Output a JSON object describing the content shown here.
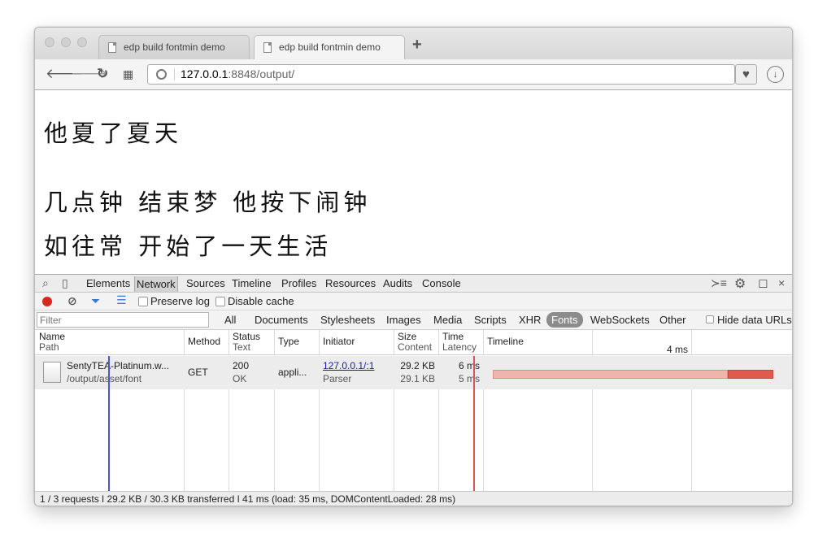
{
  "browser": {
    "tabs": [
      {
        "title": "edp build fontmin demo"
      },
      {
        "title": "edp build fontmin demo"
      }
    ],
    "url_host": "127.0.0.1",
    "url_rest": ":8848/output/"
  },
  "page": {
    "lines": [
      "他夏了夏天",
      "几点钟 结束梦 他按下闹钟",
      "如往常 开始了一天生活"
    ]
  },
  "devtools": {
    "panels": [
      "Elements",
      "Network",
      "Sources",
      "Timeline",
      "Profiles",
      "Resources",
      "Audits",
      "Console"
    ],
    "selected_panel": "Network",
    "preserve_log": "Preserve log",
    "disable_cache": "Disable cache",
    "filter_placeholder": "Filter",
    "types": [
      "All",
      "Documents",
      "Stylesheets",
      "Images",
      "Media",
      "Scripts",
      "XHR",
      "Fonts",
      "WebSockets",
      "Other"
    ],
    "selected_type": "Fonts",
    "hide_data_urls": "Hide data URLs",
    "columns": {
      "name": "Name",
      "path": "Path",
      "method": "Method",
      "status": "Status",
      "text": "Text",
      "type": "Type",
      "initiator": "Initiator",
      "size": "Size",
      "content": "Content",
      "time": "Time",
      "latency": "Latency",
      "timeline": "Timeline",
      "timeline_tick": "4 ms"
    },
    "rows": [
      {
        "name": "SentyTEA-Platinum.w...",
        "path": "/output/asset/font",
        "method": "GET",
        "status": "200",
        "status_text": "OK",
        "type": "appli...",
        "initiator": "127.0.0.1/:1",
        "initiator_type": "Parser",
        "size": "29.2 KB",
        "content": "29.1 KB",
        "time": "6 ms",
        "latency": "5 ms"
      }
    ],
    "status_bar": "1 / 3 requests ǀ 29.2 KB / 30.3 KB transferred ǀ 41 ms (load: 35 ms, DOMContentLoaded: 28 ms)"
  },
  "colors": {
    "record": "#d8291f",
    "timeline_bar": "#e05a4e",
    "dom_content_line": "#4f55c8",
    "load_line": "#e05252"
  }
}
